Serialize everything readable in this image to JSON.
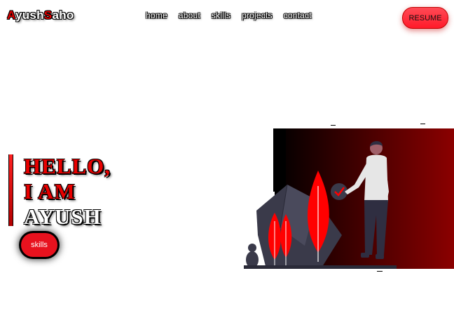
{
  "navbar": {
    "logo": {
      "first_initial": "A",
      "first_rest": "yush",
      "last_initial": "S",
      "last_rest": "aho"
    },
    "links": [
      "home",
      "about",
      "skills",
      "projects",
      "contact"
    ],
    "resume_label": "RESUME"
  },
  "hero": {
    "line1": "HELLO,",
    "line2": "I AM",
    "line3": "AYUSH",
    "skills_label": "skills"
  },
  "illustration": {
    "subject": "person-with-plants",
    "accent_color": "#ff0000",
    "gradient": [
      "#000000",
      "#8b0000"
    ]
  }
}
